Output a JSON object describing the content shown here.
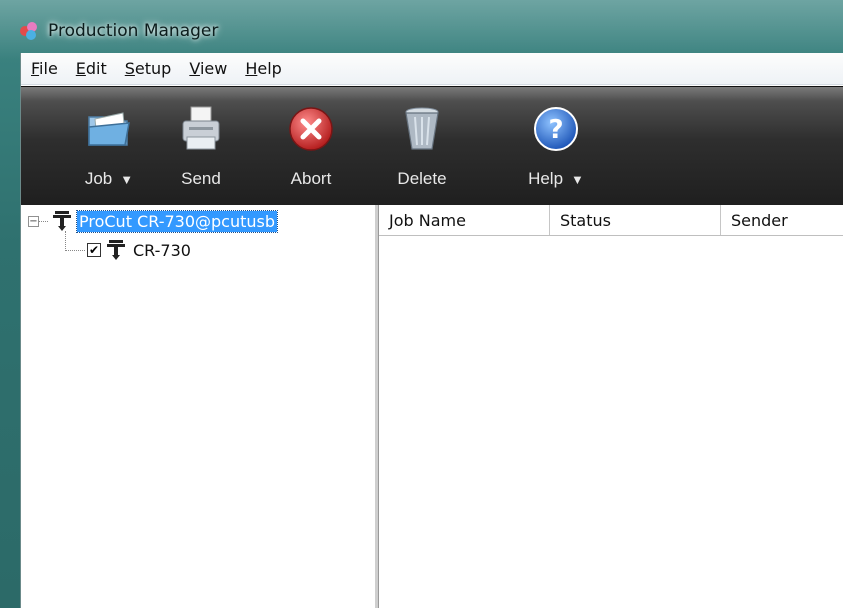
{
  "window": {
    "title": "Production Manager"
  },
  "menu": [
    {
      "label": "File",
      "mnemonic": "F",
      "rest": "ile"
    },
    {
      "label": "Edit",
      "mnemonic": "E",
      "rest": "dit"
    },
    {
      "label": "Setup",
      "mnemonic": "S",
      "rest": "etup"
    },
    {
      "label": "View",
      "mnemonic": "V",
      "rest": "iew"
    },
    {
      "label": "Help",
      "mnemonic": "H",
      "rest": "elp"
    }
  ],
  "toolbar": {
    "job": {
      "label": "Job",
      "arrow": "▼",
      "icon": "folder-icon"
    },
    "send": {
      "label": "Send",
      "icon": "printer-icon"
    },
    "abort": {
      "label": "Abort",
      "icon": "abort-icon"
    },
    "delete": {
      "label": "Delete",
      "icon": "trash-icon"
    },
    "help": {
      "label": "Help",
      "arrow": "▼",
      "icon": "help-icon"
    }
  },
  "tree": {
    "root": {
      "label": "ProCut CR-730@pcutusb",
      "expander": "−",
      "icon": "cutter-icon"
    },
    "child": {
      "label": "CR-730",
      "checked": "✔",
      "icon": "cutter-icon"
    }
  },
  "job_list": {
    "columns": [
      {
        "label": "Job Name"
      },
      {
        "label": "Status"
      },
      {
        "label": "Sender"
      }
    ],
    "rows": []
  },
  "colors": {
    "selection": "#3399ff",
    "toolbar_bg": "#1f1f1f",
    "abort_red": "#d93a3a",
    "help_blue": "#2b6fd6"
  }
}
